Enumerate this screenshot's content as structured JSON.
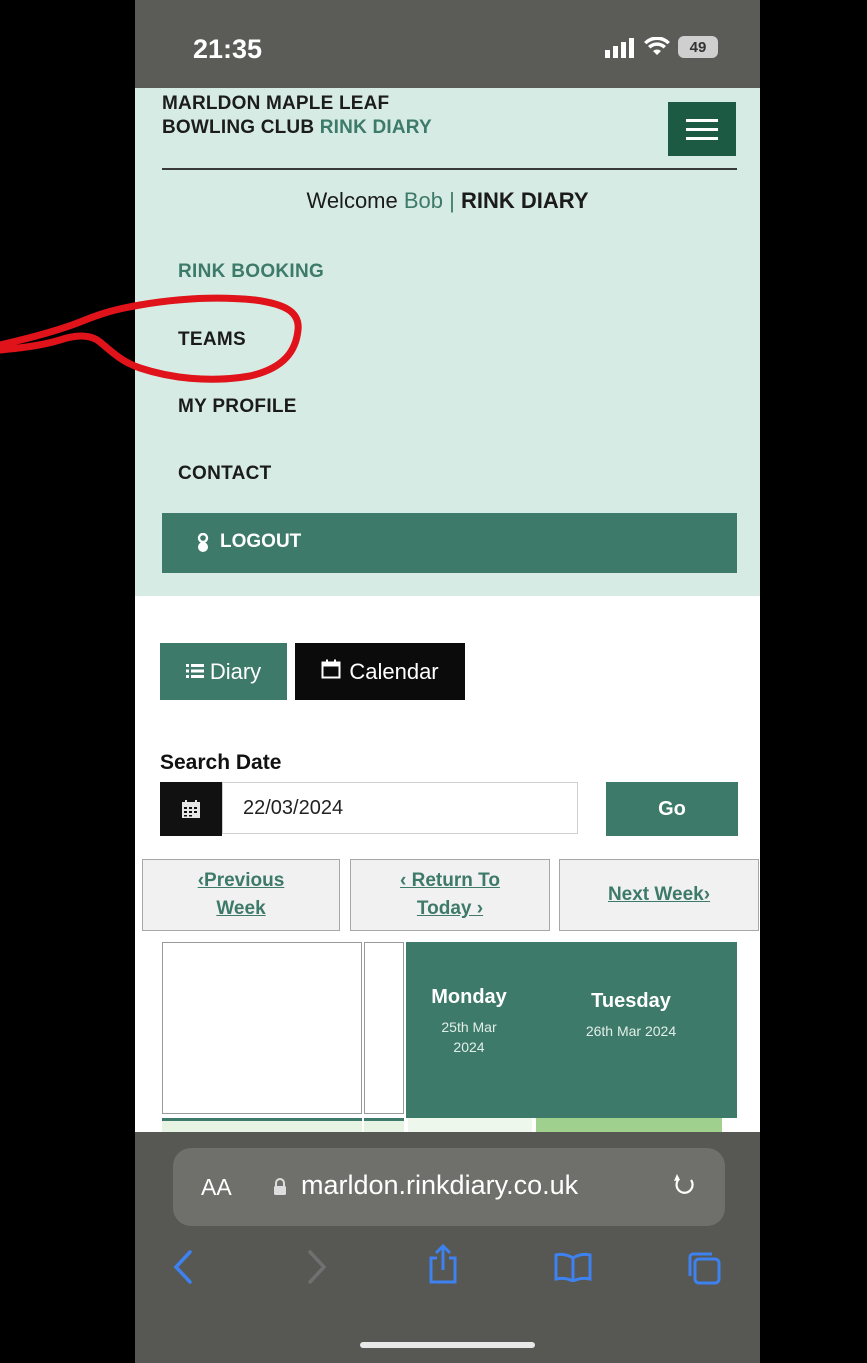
{
  "status_bar": {
    "time": "21:35",
    "battery": "49"
  },
  "header": {
    "title_black": "MARLDON MAPLE LEAF BOWLING CLUB",
    "title_green": "RINK DIARY"
  },
  "welcome": {
    "prefix": "Welcome",
    "name": "Bob",
    "separator": "|",
    "section": "RINK DIARY"
  },
  "nav": {
    "items": [
      {
        "label": "RINK BOOKING",
        "active": true
      },
      {
        "label": "TEAMS"
      },
      {
        "label": "MY PROFILE"
      },
      {
        "label": "CONTACT"
      }
    ],
    "logout_label": "LOGOUT"
  },
  "view_toggle": {
    "diary_label": "Diary",
    "calendar_label": "Calendar"
  },
  "search": {
    "label": "Search Date",
    "value": "22/03/2024",
    "go_label": "Go"
  },
  "week_nav": {
    "previous_label": "Previous Week",
    "today_label": "Return To Today",
    "next_label": "Next Week"
  },
  "days": [
    {
      "name": "Monday",
      "date": "25th Mar 2024"
    },
    {
      "name": "Tuesday",
      "date": "26th Mar 2024"
    }
  ],
  "browser": {
    "text_size_label": "AA",
    "url": "marldon.rinkdiary.co.uk"
  },
  "colors": {
    "brand_green": "#3d7a69",
    "dark_green": "#1d5a44",
    "panel_bg": "#d6ebe3",
    "annotation_red": "#e0121a"
  }
}
